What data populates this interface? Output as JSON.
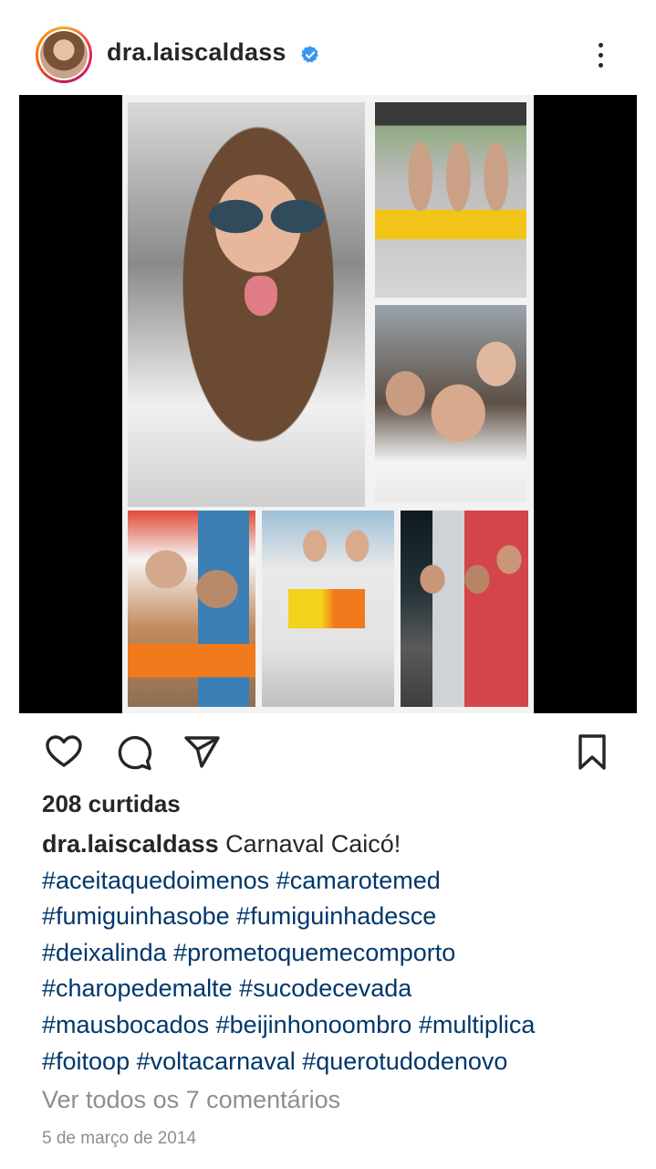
{
  "header": {
    "username": "dra.laiscaldass",
    "verified": true,
    "more_icon": "more-vertical-icon"
  },
  "post": {
    "media_icon": "photo-collage",
    "likes_text": "208 curtidas",
    "caption": {
      "username": "dra.laiscaldass",
      "text": "Carnaval Caicó!",
      "hashtags": [
        "#aceitaquedoimenos",
        "#camarotemed",
        "#fumiguinhasobe",
        "#fumiguinhadesce",
        "#deixalinda",
        "#prometoquemecomporto",
        "#charopedemalte",
        "#sucodecevada",
        "#mausbocados",
        "#beijinhonoombro",
        "#multiplica",
        "#foitoop",
        "#voltacarnaval",
        "#querotudodenovo"
      ]
    },
    "view_comments_text": "Ver todos os 7 comentários",
    "date_text": "5 de março de 2014"
  },
  "actions": {
    "like_icon": "heart-icon",
    "comment_icon": "comment-icon",
    "share_icon": "send-icon",
    "save_icon": "bookmark-icon"
  },
  "colors": {
    "text": "#262626",
    "hashtag": "#00376b",
    "muted": "#8e8e8e",
    "verified": "#3897f0"
  }
}
